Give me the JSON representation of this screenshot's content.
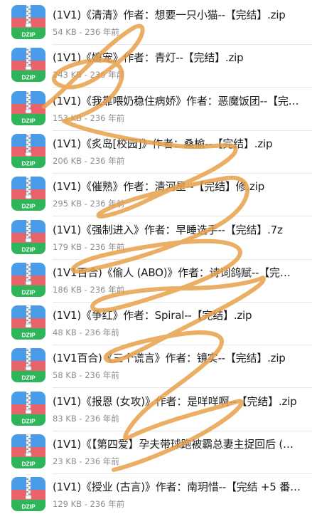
{
  "icon": {
    "label": "DZIP",
    "colors": {
      "top": "#4a9be8",
      "middle": "#e8646a",
      "bottom": "#2eb55a",
      "zipper": "#f2f2f2"
    }
  },
  "overlay": {
    "color": "#e8a04a",
    "type": "hand-drawn scribble"
  },
  "files": [
    {
      "name": "(1V1)《清清》作者：想要一只小猫--【完结】.zip",
      "size": "54 KB",
      "time": "236 年前"
    },
    {
      "name": "(1V1)《嬗宠》作者：青灯--【完结】.zip",
      "size": "243 KB",
      "time": "236 年前"
    },
    {
      "name": "(1V1)《我靠喂奶稳住病娇》作者：恶魔饭团--【完…",
      "size": "153 KB",
      "time": "236 年前"
    },
    {
      "name": "(1V1)《炙岛[校园]》作者：桑榆--【完结】.zip",
      "size": "206 KB",
      "time": "236 年前"
    },
    {
      "name": "(1V1)《催熟》作者：清河星--【完结】修.zip",
      "size": "295 KB",
      "time": "236 年前"
    },
    {
      "name": "(1V1)《强制进入》作者：早睡选手--【完结】.7z",
      "size": "179 KB",
      "time": "236 年前"
    },
    {
      "name": "(1V1百合)《偷人 (ABO)》作者：诗词鸽赋--【完…",
      "size": "186 KB",
      "time": "236 年前"
    },
    {
      "name": "(1V1)《争红》作者：Spiral--【完结】.zip",
      "size": "48 KB",
      "time": "236 年前"
    },
    {
      "name": "(1V1百合)《三个谎言》作者：镜实--【完结】.zip",
      "size": "58 KB",
      "time": "236 年前"
    },
    {
      "name": "(1V1)《报恩 (女攻)》作者：是咩咩啊--【完结】.zip",
      "size": "83 KB",
      "time": "236 年前"
    },
    {
      "name": "(1V1)《【第四爱】孕夫带球跑被霸总妻主捉回后 (…",
      "size": "23 KB",
      "time": "236 年前"
    },
    {
      "name": "(1V1)《授业 (古言)》作者：南玥惜--【完结 +5 番…",
      "size": "129 KB",
      "time": "236 年前"
    }
  ]
}
